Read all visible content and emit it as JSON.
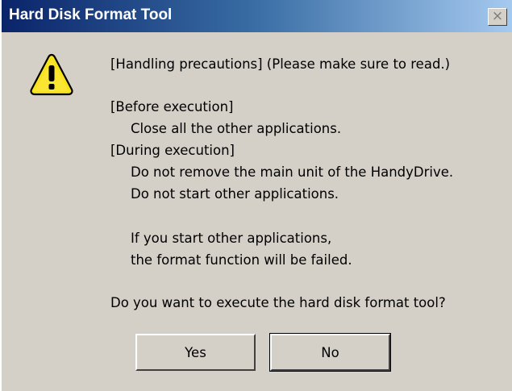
{
  "window": {
    "title": "Hard Disk Format Tool",
    "close_glyph": "×"
  },
  "icon": "warning-icon",
  "message": {
    "heading": "[Handling precautions] (Please make sure to read.)",
    "before_header": "[Before execution]",
    "before_item": "Close all the other applications.",
    "during_header": "[During execution]",
    "during_item_1": "Do not remove the main unit of the HandyDrive.",
    "during_item_2": "Do not start other applications.",
    "note_line_1": "If you start other applications,",
    "note_line_2": "the format function will be failed.",
    "question": "Do you want to execute the hard disk format tool?"
  },
  "buttons": {
    "yes": "Yes",
    "no": "No"
  }
}
